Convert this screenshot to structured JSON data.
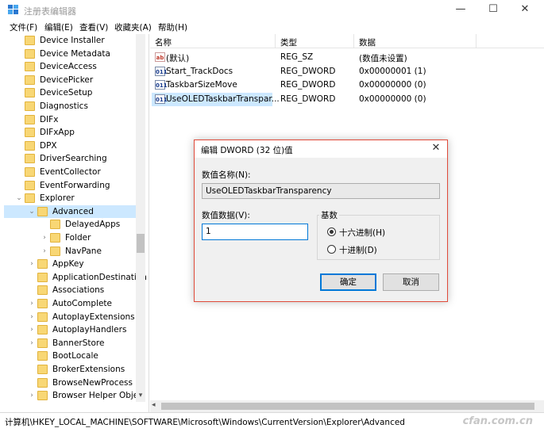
{
  "window": {
    "title": "注册表编辑器",
    "minimize": "—",
    "maximize": "☐",
    "close": "✕"
  },
  "menu": [
    "文件(F)",
    "编辑(E)",
    "查看(V)",
    "收藏夹(A)",
    "帮助(H)"
  ],
  "tree": [
    {
      "label": "Device Installer",
      "level": 0,
      "arrow": ""
    },
    {
      "label": "Device Metadata",
      "level": 0,
      "arrow": ""
    },
    {
      "label": "DeviceAccess",
      "level": 0,
      "arrow": ""
    },
    {
      "label": "DevicePicker",
      "level": 0,
      "arrow": ""
    },
    {
      "label": "DeviceSetup",
      "level": 0,
      "arrow": ""
    },
    {
      "label": "Diagnostics",
      "level": 0,
      "arrow": ""
    },
    {
      "label": "DIFx",
      "level": 0,
      "arrow": ""
    },
    {
      "label": "DIFxApp",
      "level": 0,
      "arrow": ""
    },
    {
      "label": "DPX",
      "level": 0,
      "arrow": ""
    },
    {
      "label": "DriverSearching",
      "level": 0,
      "arrow": ""
    },
    {
      "label": "EventCollector",
      "level": 0,
      "arrow": ""
    },
    {
      "label": "EventForwarding",
      "level": 0,
      "arrow": ""
    },
    {
      "label": "Explorer",
      "level": 0,
      "arrow": "open"
    },
    {
      "label": "Advanced",
      "level": 1,
      "arrow": "open",
      "selected": true
    },
    {
      "label": "DelayedApps",
      "level": 2,
      "arrow": ""
    },
    {
      "label": "Folder",
      "level": 2,
      "arrow": "closed"
    },
    {
      "label": "NavPane",
      "level": 2,
      "arrow": "closed"
    },
    {
      "label": "AppKey",
      "level": 1,
      "arrow": "closed"
    },
    {
      "label": "ApplicationDestination",
      "level": 1,
      "arrow": ""
    },
    {
      "label": "Associations",
      "level": 1,
      "arrow": ""
    },
    {
      "label": "AutoComplete",
      "level": 1,
      "arrow": "closed"
    },
    {
      "label": "AutoplayExtensions",
      "level": 1,
      "arrow": "closed"
    },
    {
      "label": "AutoplayHandlers",
      "level": 1,
      "arrow": "closed"
    },
    {
      "label": "BannerStore",
      "level": 1,
      "arrow": "closed"
    },
    {
      "label": "BootLocale",
      "level": 1,
      "arrow": ""
    },
    {
      "label": "BrokerExtensions",
      "level": 1,
      "arrow": ""
    },
    {
      "label": "BrowseNewProcess",
      "level": 1,
      "arrow": ""
    },
    {
      "label": "Browser Helper Obje",
      "level": 1,
      "arrow": "closed"
    }
  ],
  "list": {
    "columns": [
      "名称",
      "类型",
      "数据"
    ],
    "rows": [
      {
        "icon": "ab",
        "name": "(默认)",
        "type": "REG_SZ",
        "data": "(数值未设置)"
      },
      {
        "icon": "011",
        "name": "Start_TrackDocs",
        "type": "REG_DWORD",
        "data": "0x00000001 (1)"
      },
      {
        "icon": "011",
        "name": "TaskbarSizeMove",
        "type": "REG_DWORD",
        "data": "0x00000000 (0)"
      },
      {
        "icon": "011",
        "name": "UseOLEDTaskbarTranspar...",
        "type": "REG_DWORD",
        "data": "0x00000000 (0)",
        "selected": true
      }
    ]
  },
  "status": {
    "path": "计算机\\HKEY_LOCAL_MACHINE\\SOFTWARE\\Microsoft\\Windows\\CurrentVersion\\Explorer\\Advanced",
    "watermark": "cfan.com.cn"
  },
  "dialog": {
    "title": "编辑 DWORD (32 位)值",
    "close": "✕",
    "name_label": "数值名称(N):",
    "name_value": "UseOLEDTaskbarTransparency",
    "data_label": "数值数据(V):",
    "data_value": "1",
    "base_label": "基数",
    "hex_label": "十六进制(H)",
    "dec_label": "十进制(D)",
    "base_selected": "hex",
    "ok": "确定",
    "cancel": "取消"
  },
  "scroll": {
    "down_arrow": "▾",
    "left_arrow": "◂"
  }
}
